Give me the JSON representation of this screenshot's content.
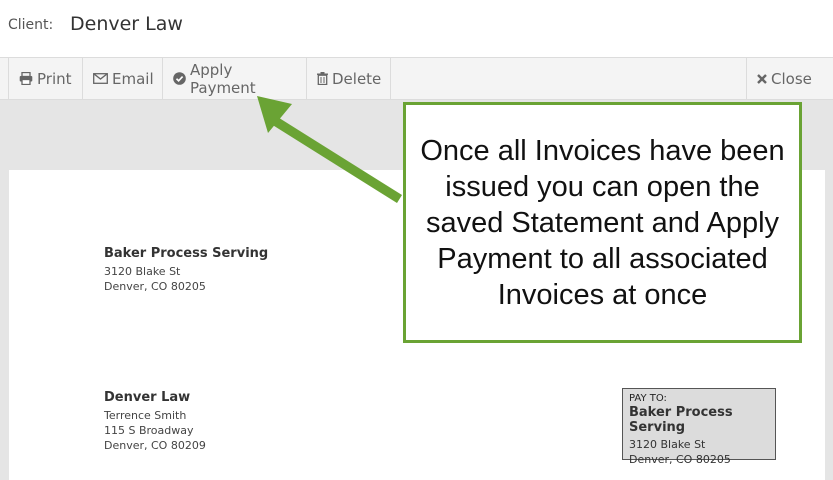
{
  "client": {
    "label": "Client:",
    "name": "Denver Law"
  },
  "toolbar": {
    "print": {
      "label": "Print",
      "icon": "print-icon"
    },
    "email": {
      "label": "Email",
      "icon": "envelope-icon"
    },
    "apply_payment": {
      "label": "Apply Payment",
      "icon": "check-circle-icon"
    },
    "delete": {
      "label": "Delete",
      "icon": "trash-icon"
    },
    "close": {
      "label": "Close",
      "icon": "close-icon"
    }
  },
  "from_address": {
    "name": "Baker Process Serving",
    "line1": "3120 Blake St",
    "line2": "Denver, CO 80205"
  },
  "to_address": {
    "name": "Denver Law",
    "line1": "Terrence Smith",
    "line2": "115 S Broadway",
    "line3": "Denver, CO 80209"
  },
  "pay_to": {
    "header": "PAY TO:",
    "name": "Baker Process Serving",
    "line1": "3120 Blake St",
    "line2": "Denver, CO 80205"
  },
  "callout": {
    "text": "Once all Invoices have been issued you can open the saved Statement and Apply Payment to all associated Invoices at once"
  },
  "colors": {
    "callout_border": "#6aa334",
    "arrow": "#6aa334"
  }
}
